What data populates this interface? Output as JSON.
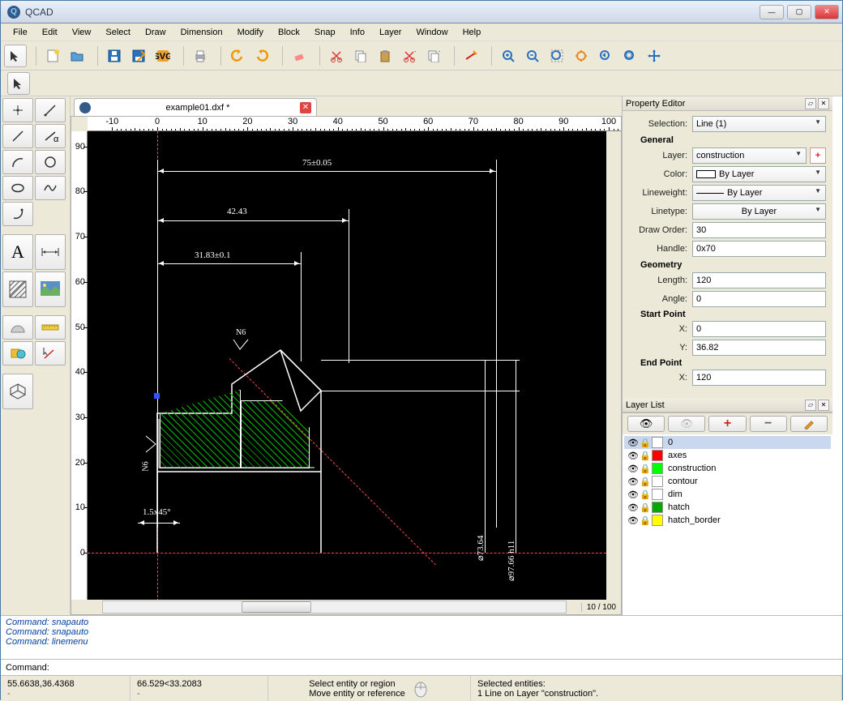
{
  "window": {
    "title": "QCAD"
  },
  "menu": [
    "File",
    "Edit",
    "View",
    "Select",
    "Draw",
    "Dimension",
    "Modify",
    "Block",
    "Snap",
    "Info",
    "Layer",
    "Window",
    "Help"
  ],
  "tabs": [
    {
      "name": "example01.dxf *"
    }
  ],
  "ruler_h_ticks": [
    -10,
    0,
    10,
    20,
    30,
    40,
    50,
    60,
    70,
    80,
    90,
    100
  ],
  "ruler_v_ticks": [
    0,
    10,
    20,
    30,
    40,
    50,
    60,
    70,
    80,
    90
  ],
  "scroll_readout": "10 / 100",
  "canvas_dims": {
    "dim1": "75±0.05",
    "dim2": "42.43",
    "dim3": "31.83±0.1",
    "chamfer": "1.5x45°",
    "surf1": "N6",
    "surf2": "N6",
    "dia1": "⌀73.64",
    "dia2": "⌀97.66 h11"
  },
  "property_editor": {
    "title": "Property Editor",
    "selection_label": "Selection:",
    "selection_value": "Line (1)",
    "groups": {
      "general": "General",
      "geometry": "Geometry"
    },
    "labels": {
      "layer": "Layer:",
      "color": "Color:",
      "lineweight": "Lineweight:",
      "linetype": "Linetype:",
      "draworder": "Draw Order:",
      "handle": "Handle:",
      "length": "Length:",
      "angle": "Angle:",
      "start": "Start Point",
      "x": "X:",
      "y": "Y:",
      "end": "End Point"
    },
    "values": {
      "layer": "construction",
      "color": "By Layer",
      "lineweight": "By Layer",
      "linetype": "By Layer",
      "draworder": "30",
      "handle": "0x70",
      "length": "120",
      "angle": "0",
      "start_x": "0",
      "start_y": "36.82",
      "end_x": "120"
    }
  },
  "layer_panel": {
    "title": "Layer List",
    "layers": [
      {
        "name": "0",
        "color": "#ffffff",
        "selected": true
      },
      {
        "name": "axes",
        "color": "#ff0000"
      },
      {
        "name": "construction",
        "color": "#00ff00"
      },
      {
        "name": "contour",
        "color": "#ffffff"
      },
      {
        "name": "dim",
        "color": "#ffffff"
      },
      {
        "name": "hatch",
        "color": "#00aa00"
      },
      {
        "name": "hatch_border",
        "color": "#ffff00"
      }
    ]
  },
  "command_history": [
    "Command: snapauto",
    "Command: snapauto",
    "Command: linemenu"
  ],
  "command_prompt": "Command:",
  "status": {
    "abs_coord": "55.6638,36.4368",
    "rel_coord": "66.529<33.2083",
    "dash": "-",
    "hint1": "Select entity or region",
    "hint2": "Move entity or reference",
    "sel1": "Selected entities:",
    "sel2": "1 Line on Layer \"construction\"."
  }
}
